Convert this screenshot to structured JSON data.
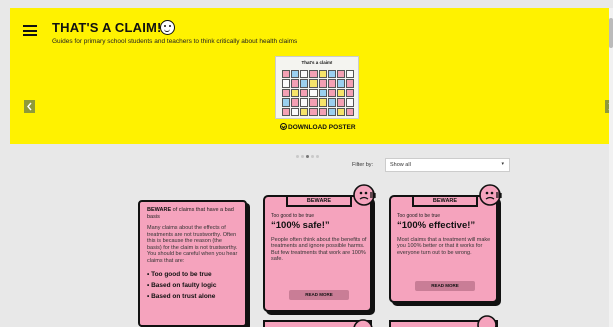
{
  "header": {
    "title": "THAT'S A CLAIM!",
    "tagline": "Guides for primary school students and teachers to think critically about health claims"
  },
  "poster": {
    "title": "That's a claim!",
    "download_label": "DOWNLOAD POSTER"
  },
  "filter": {
    "label": "Filter by:",
    "selected": "Show all"
  },
  "carousel": {
    "active_dot": 3,
    "dot_count": 5
  },
  "intro_card": {
    "lead_bold": "BEWARE",
    "lead_rest": " of claims that have a bad basis",
    "body": "Many claims about the effects of treatments are not trustworthy. Often this is because the reason (the basis) for the claim is not trustworthy. You should be careful when you hear claims that are:",
    "points": [
      "Too good to be true",
      "Based on faulty logic",
      "Based on trust alone"
    ]
  },
  "cards": [
    {
      "badge": "BEWARE",
      "category": "Too good to be true",
      "headline": "“100% safe!”",
      "description": "People often think about the benefits of treatments and ignore possible harms. But few treatments that work are 100% safe.",
      "button": "READ MORE"
    },
    {
      "badge": "BEWARE",
      "category": "Too good to be true",
      "headline": "“100% effective!”",
      "description": "Most claims that a treatment will make you 100% better or that it works for everyone turn out to be wrong.",
      "button": "READ MORE"
    }
  ],
  "colors": {
    "banner": "#fff200",
    "card": "#f5a3bd",
    "button": "#c97d96",
    "arrow": "#8f9a3a"
  },
  "icons": [
    "menu-icon",
    "logo-face-icon",
    "arrow-left-icon",
    "arrow-right-icon",
    "download-icon",
    "mascot-icon"
  ]
}
